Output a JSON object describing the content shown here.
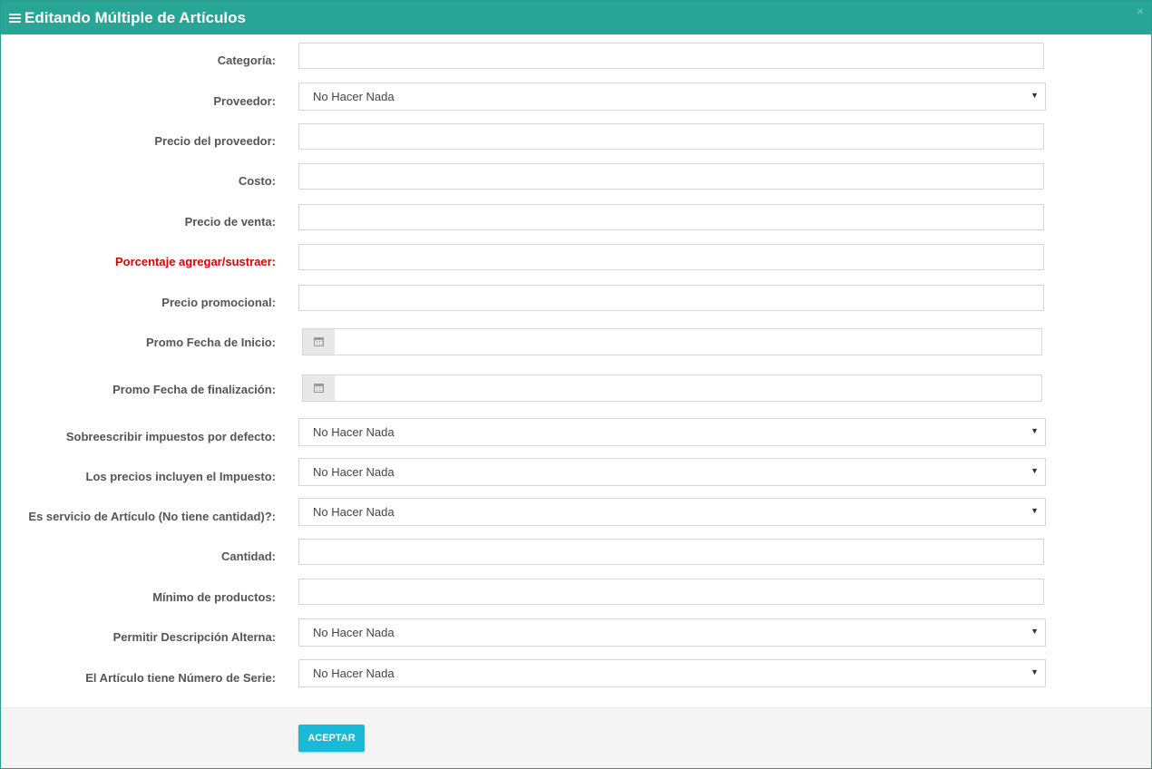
{
  "modal": {
    "title": "Editando Múltiple de Artículos",
    "close": "×"
  },
  "fields": {
    "categoria": {
      "label": "Categoría:",
      "value": ""
    },
    "proveedor": {
      "label": "Proveedor:",
      "value": "No Hacer Nada"
    },
    "precio_proveedor": {
      "label": "Precio del proveedor:",
      "value": ""
    },
    "costo": {
      "label": "Costo:",
      "value": ""
    },
    "precio_venta": {
      "label": "Precio de venta:",
      "value": ""
    },
    "porcentaje": {
      "label": "Porcentaje agregar/sustraer:",
      "value": ""
    },
    "precio_promocional": {
      "label": "Precio promocional:",
      "value": ""
    },
    "promo_inicio": {
      "label": "Promo Fecha de Inicio:",
      "value": ""
    },
    "promo_fin": {
      "label": "Promo Fecha de finalización:",
      "value": ""
    },
    "sobreescribir_impuestos": {
      "label": "Sobreescribir impuestos por defecto:",
      "value": "No Hacer Nada"
    },
    "precios_incluyen_impuesto": {
      "label": "Los precios incluyen el Impuesto:",
      "value": "No Hacer Nada"
    },
    "es_servicio": {
      "label": "Es servicio de Artículo (No tiene cantidad)?:",
      "value": "No Hacer Nada"
    },
    "cantidad": {
      "label": "Cantidad:",
      "value": ""
    },
    "minimo_productos": {
      "label": "Mínimo de productos:",
      "value": ""
    },
    "descripcion_alterna": {
      "label": "Permitir Descripción Alterna:",
      "value": "No Hacer Nada"
    },
    "numero_serie": {
      "label": "El Artículo tiene Número de Serie:",
      "value": "No Hacer Nada"
    }
  },
  "footer": {
    "accept_label": "ACEPTAR"
  },
  "colors": {
    "header": "#27a595",
    "accent_button": "#19b9d8",
    "warning_label": "#e00000"
  },
  "icons": {
    "header": "bars-icon",
    "date": "calendar-icon",
    "select": "caret-down-icon",
    "close": "close-icon"
  }
}
